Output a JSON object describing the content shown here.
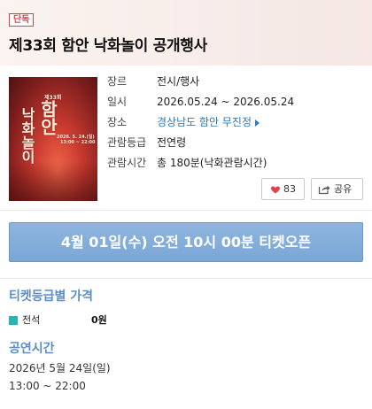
{
  "header": {
    "badge": "단독",
    "title": "제33회 함안 낙화놀이 공개행사"
  },
  "poster": {
    "small_top": "제33회",
    "big1": "함안",
    "big2": "낙화놀이",
    "date_line": "2026. 5. 24.(일)",
    "sub_line": "13:00 ~ 22:00"
  },
  "info": {
    "rows": [
      {
        "key": "장르",
        "value": "전시/행사"
      },
      {
        "key": "일시",
        "value": "2026.05.24 ~ 2026.05.24"
      },
      {
        "key": "장소",
        "value": "경상남도 함안 무진정"
      },
      {
        "key": "관람등급",
        "value": "전연령"
      },
      {
        "key": "관람시간",
        "value": "총 180분(낙화관람시간)"
      }
    ]
  },
  "actions": {
    "like_count": "83",
    "share_label": "공유"
  },
  "ticket_open": {
    "label": "4월 01일(수) 오전 10시 00분 티켓오픈"
  },
  "price_section": {
    "title": "티켓등급별 가격",
    "grades": [
      {
        "name": "전석",
        "price": "0원",
        "color": "#2ab3b5"
      }
    ]
  },
  "schedule_section": {
    "title": "공연시간",
    "date": "2026년 5월 24일(일)",
    "time": "13:00 ~ 22:00"
  },
  "colors": {
    "accent": "#5b8dc7",
    "link": "#2b7bbf",
    "badge": "#e0424b",
    "heart": "#e0424b",
    "open_button": "#7aa6d6"
  }
}
